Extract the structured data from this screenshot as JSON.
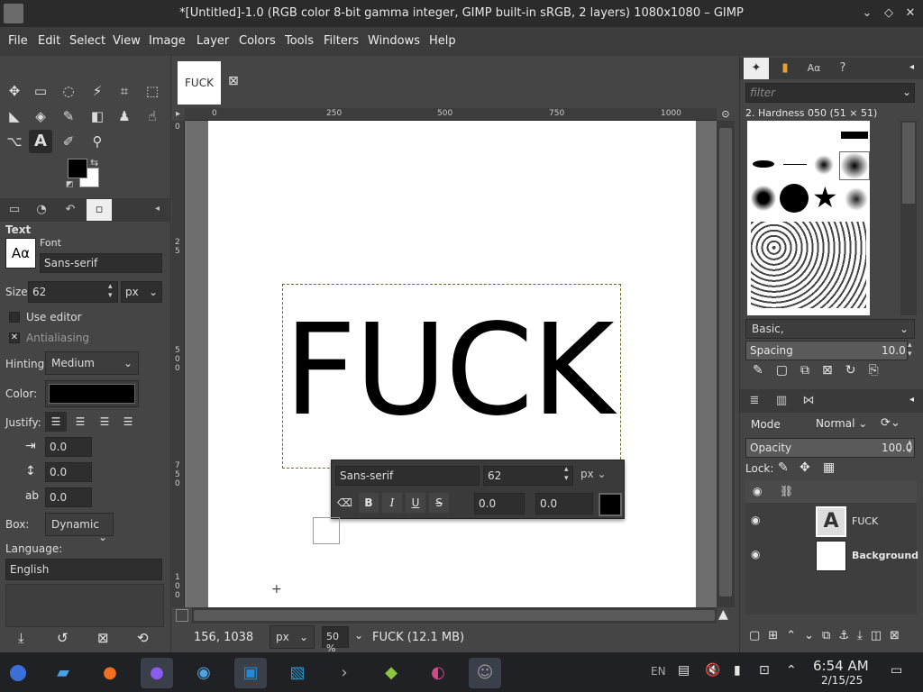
{
  "window": {
    "title": "*[Untitled]-1.0 (RGB color 8-bit gamma integer, GIMP built-in sRGB, 2 layers) 1080x1080 – GIMP",
    "controls": [
      "⌄",
      "◇",
      "✕"
    ]
  },
  "menu": [
    "File",
    "Edit",
    "Select",
    "View",
    "Image",
    "Layer",
    "Colors",
    "Tools",
    "Filters",
    "Windows",
    "Help"
  ],
  "colors": {
    "foreground": "#000000",
    "background": "#ffffff"
  },
  "tool_options": {
    "title": "Text",
    "font_label": "Font",
    "font_preview": "Aα",
    "font_value": "Sans-serif",
    "size_label": "Size:",
    "size_value": "62",
    "size_unit": "px",
    "use_editor": "Use editor",
    "antialiasing": "Antialiasing",
    "hinting_label": "Hinting:",
    "hinting_value": "Medium",
    "color_label": "Color:",
    "color_value": "#000000",
    "justify_label": "Justify:",
    "indent_value": "0.0",
    "line_spacing_value": "0.0",
    "letter_spacing_value": "0.0",
    "box_label": "Box:",
    "box_value": "Dynamic",
    "language_label": "Language:",
    "language_value": "English"
  },
  "image_tab": {
    "label": "FUCK"
  },
  "ruler": {
    "top_ticks": [
      "0",
      "250",
      "500",
      "750",
      "1000"
    ],
    "left_ticks": [
      "2",
      "5",
      "0",
      "5",
      "0",
      "0",
      "7",
      "5",
      "0",
      "1",
      "0",
      "0",
      "0"
    ]
  },
  "canvas_text": "FUCK",
  "text_toolbox": {
    "font": "Sans-serif",
    "size": "62",
    "unit": "px",
    "bold": "B",
    "italic": "I",
    "underline": "U",
    "strike": "S",
    "baseline": "0.0",
    "kerning": "0.0"
  },
  "status": {
    "coords": "156, 1038",
    "unit": "px",
    "zoom": "50 %",
    "info": "FUCK (12.1 MB)"
  },
  "brushes": {
    "filter_placeholder": "filter",
    "current": "2. Hardness 050 (51 × 51)",
    "preset": "Basic,",
    "spacing_label": "Spacing",
    "spacing_value": "10.0"
  },
  "layers": {
    "mode_label": "Mode",
    "mode_value": "Normal",
    "opacity_label": "Opacity",
    "opacity_value": "100.0",
    "lock_label": "Lock:",
    "items": [
      {
        "name": "FUCK",
        "thumb": "A"
      },
      {
        "name": "Background",
        "thumb": ""
      }
    ]
  },
  "taskbar": {
    "lang": "EN",
    "time": "6:54 AM",
    "date": "2/15/25"
  }
}
